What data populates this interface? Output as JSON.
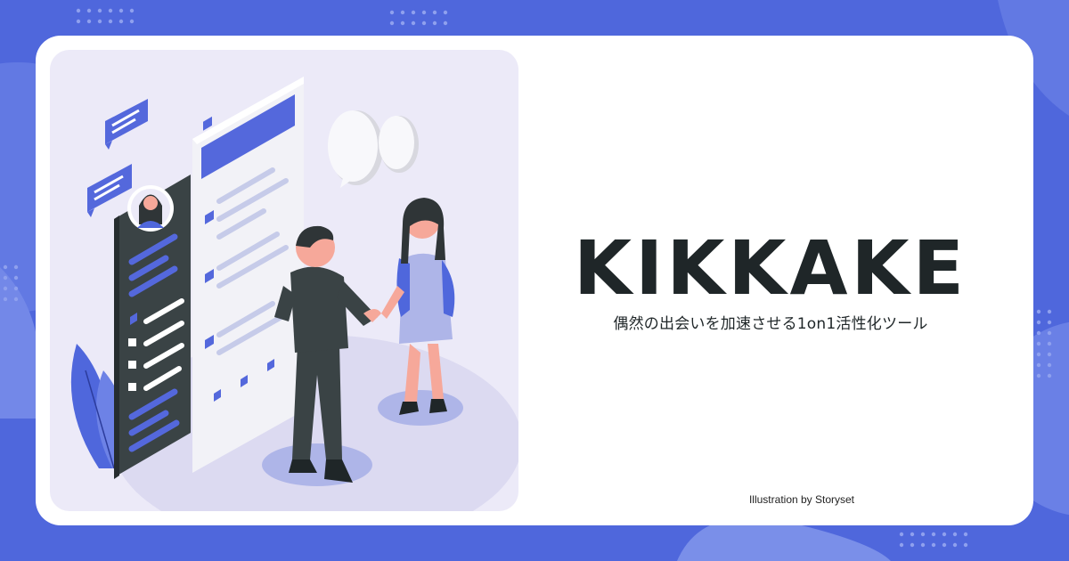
{
  "brand": {
    "name": "KIKKAKE",
    "tagline": "偶然の出会いを加速させる1on1活性化ツール"
  },
  "credit": "Illustration by Storyset",
  "colors": {
    "background": "#4f67dc",
    "card": "#ffffff",
    "illustration_panel": "#eceaf8",
    "accent": "#5468dc",
    "text": "#1f2628"
  },
  "illustration": {
    "icons": [
      "chat-bubble-icon",
      "speech-bubble-icon",
      "profile-avatar-icon",
      "plant-icon"
    ]
  }
}
